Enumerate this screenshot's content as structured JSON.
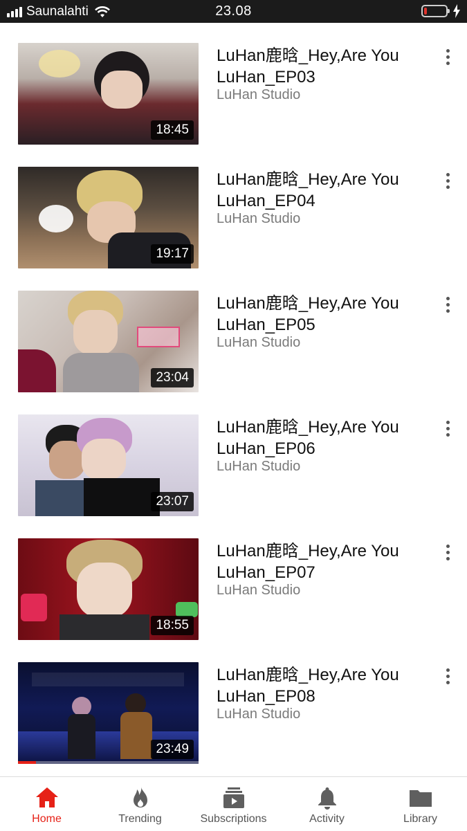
{
  "status_bar": {
    "carrier": "Saunalahti",
    "time": "23.08",
    "battery_level": 0.12,
    "charging": true
  },
  "videos": [
    {
      "title": "LuHan鹿晗_Hey,Are You LuHan_EP03",
      "channel": "LuHan Studio",
      "duration": "18:45"
    },
    {
      "title": "LuHan鹿晗_Hey,Are You LuHan_EP04",
      "channel": "LuHan Studio",
      "duration": "19:17"
    },
    {
      "title": "LuHan鹿晗_Hey,Are You LuHan_EP05",
      "channel": "LuHan Studio",
      "duration": "23:04"
    },
    {
      "title": "LuHan鹿晗_Hey,Are You LuHan_EP06",
      "channel": "LuHan Studio",
      "duration": "23:07"
    },
    {
      "title": "LuHan鹿晗_Hey,Are You LuHan_EP07",
      "channel": "LuHan Studio",
      "duration": "18:55"
    },
    {
      "title": "LuHan鹿晗_Hey,Are You LuHan_EP08",
      "channel": "LuHan Studio",
      "duration": "23:49",
      "watch_progress": 0.1
    }
  ],
  "bottom_nav": {
    "active": "home",
    "tabs": [
      {
        "id": "home",
        "label": "Home",
        "icon": "home-icon"
      },
      {
        "id": "trending",
        "label": "Trending",
        "icon": "flame-icon"
      },
      {
        "id": "subscriptions",
        "label": "Subscriptions",
        "icon": "subscriptions-icon"
      },
      {
        "id": "activity",
        "label": "Activity",
        "icon": "bell-icon"
      },
      {
        "id": "library",
        "label": "Library",
        "icon": "folder-icon"
      }
    ]
  },
  "colors": {
    "accent": "#e62117",
    "status_bar_bg": "#1b1b1b",
    "title_text": "#111111",
    "channel_text": "#7a7a7a",
    "battery_low": "#e0332c"
  }
}
